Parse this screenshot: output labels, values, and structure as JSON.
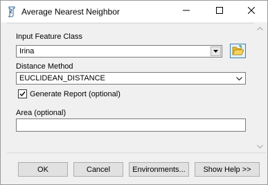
{
  "window": {
    "title": "Average Nearest Neighbor",
    "icons": {
      "app": "toolbox-script-icon",
      "minimize": "minimize-icon",
      "maximize": "maximize-icon",
      "close": "close-icon"
    }
  },
  "form": {
    "input_feature_class": {
      "label": "Input Feature Class",
      "value": "Irina"
    },
    "distance_method": {
      "label": "Distance Method",
      "value": "EUCLIDEAN_DISTANCE"
    },
    "generate_report": {
      "label": "Generate Report (optional)",
      "checked": true
    },
    "area": {
      "label": "Area (optional)",
      "value": ""
    }
  },
  "buttons": {
    "ok": "OK",
    "cancel": "Cancel",
    "environments": "Environments...",
    "show_help": "Show Help >>"
  },
  "colors": {
    "folder_yellow": "#e8b923",
    "accent_blue": "#3c7fb1"
  }
}
